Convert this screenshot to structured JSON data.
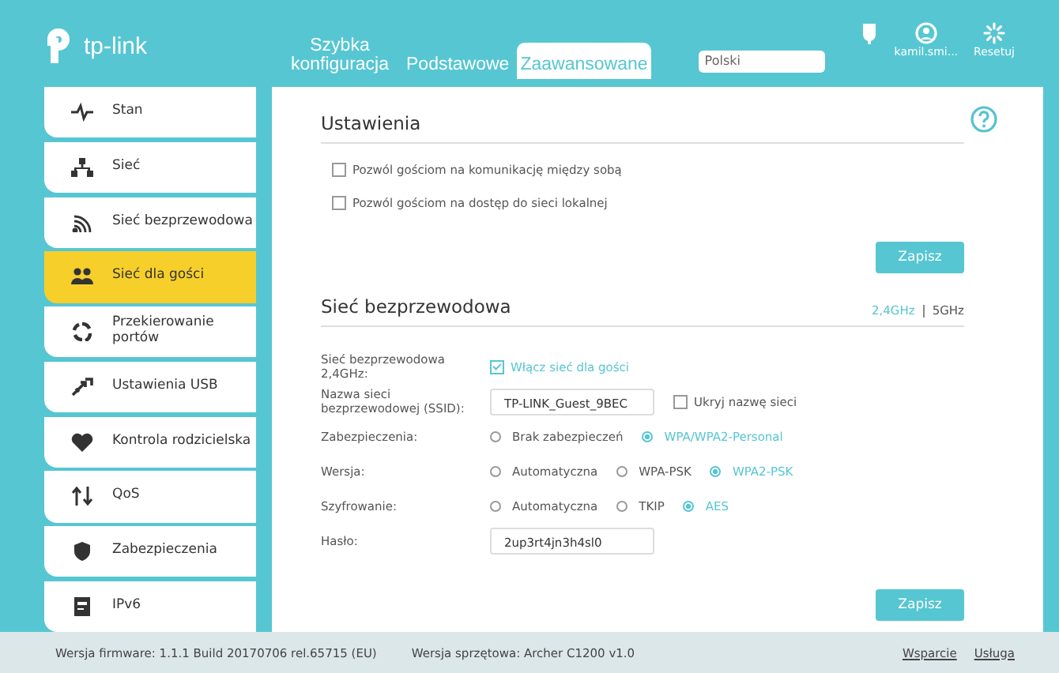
{
  "header": {
    "logo": "tp-link",
    "tabs": [
      {
        "label": "Szybka konfiguracja",
        "selected": false
      },
      {
        "label": "Podstawowe",
        "selected": false
      },
      {
        "label": "Zaawansowane",
        "selected": true
      }
    ],
    "language": {
      "value": "Polski"
    },
    "actions": [
      {
        "kind": "logout"
      },
      {
        "kind": "user",
        "label": "kamil.smi..."
      },
      {
        "kind": "reset",
        "label": "Resetuj"
      }
    ]
  },
  "sidebar": {
    "items": [
      {
        "label": "Stan",
        "selected": false
      },
      {
        "label": "Sieć",
        "selected": false
      },
      {
        "label": "Sieć bezprzewodowa",
        "selected": false
      },
      {
        "label": "Sieć dla gości",
        "selected": true
      },
      {
        "label": "Przekierowanie portów",
        "selected": false
      },
      {
        "label": "Ustawienia USB",
        "selected": false
      },
      {
        "label": "Kontrola rodzicielska",
        "selected": false
      },
      {
        "label": "QoS",
        "selected": false
      },
      {
        "label": "Zabezpieczenia",
        "selected": false
      },
      {
        "label": "IPv6",
        "selected": false
      }
    ]
  },
  "settings": {
    "title": "Ustawienia",
    "options": [
      {
        "label": "Pozwól gościom na komunikację między sobą",
        "checked": false
      },
      {
        "label": "Pozwól gościom na dostęp do sieci lokalnej",
        "checked": false
      }
    ],
    "save": "Zapisz"
  },
  "wireless": {
    "title": "Sieć bezprzewodowa",
    "bands": [
      {
        "label": "2,4GHz",
        "selected": true
      },
      {
        "label": "5GHz",
        "selected": false
      }
    ],
    "rows": [
      {
        "kind": "checkbox",
        "label": "Sieć bezprzewodowa 2,4GHz:",
        "option": {
          "label": "Włącz sieć dla gości",
          "checked": true
        }
      },
      {
        "kind": "input",
        "label": "Nazwa sieci bezprzewodowej (SSID):",
        "value": "TP-LINK_Guest_9BEC",
        "option": {
          "label": "Ukryj nazwę sieci",
          "checked": false
        }
      },
      {
        "kind": "radio",
        "label": "Zabezpieczenia:",
        "options": [
          {
            "label": "Brak zabezpieczeń",
            "selected": false
          },
          {
            "label": "WPA/WPA2-Personal",
            "selected": true
          }
        ]
      },
      {
        "kind": "radio",
        "label": "Wersja:",
        "options": [
          {
            "label": "Automatyczna",
            "selected": false
          },
          {
            "label": "WPA-PSK",
            "selected": false
          },
          {
            "label": "WPA2-PSK",
            "selected": true
          }
        ]
      },
      {
        "kind": "radio",
        "label": "Szyfrowanie:",
        "options": [
          {
            "label": "Automatyczna",
            "selected": false
          },
          {
            "label": "TKIP",
            "selected": false
          },
          {
            "label": "AES",
            "selected": true
          }
        ]
      },
      {
        "kind": "input",
        "label": "Hasło:",
        "value": "2up3rt4jn3h4sl0"
      }
    ],
    "save": "Zapisz"
  },
  "footer": {
    "firmware": "Wersja firmware: 1.1.1 Build 20170706 rel.65715 (EU)",
    "hardware": "Wersja sprzętowa: Archer C1200 v1.0",
    "links": [
      "Wsparcie",
      "Usługa"
    ]
  }
}
